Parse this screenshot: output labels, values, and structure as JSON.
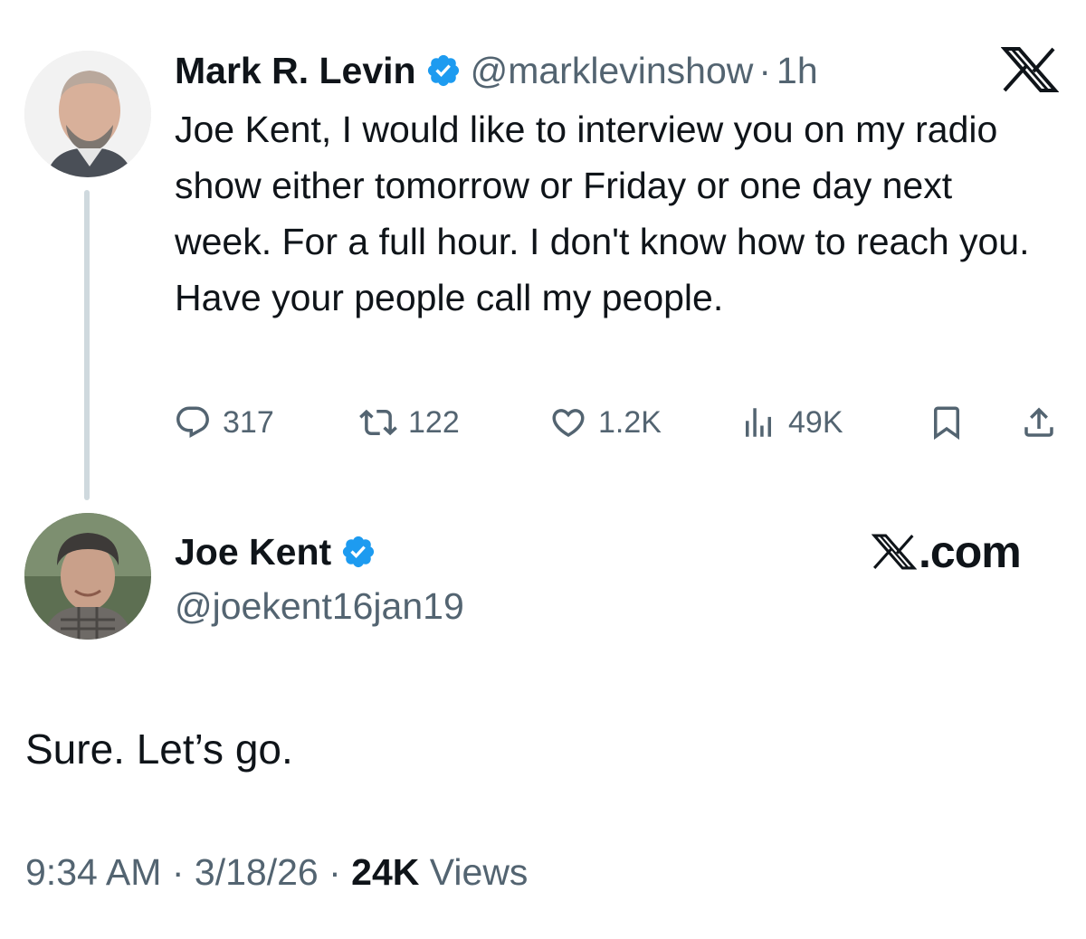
{
  "original_tweet": {
    "display_name": "Mark R. Levin",
    "verified": true,
    "handle": "@marklevinshow",
    "separator": "·",
    "time_ago": "1h",
    "text": "Joe Kent, I would like to interview you on my radio show either tomorrow or Friday or one day next week.  For a full hour.  I don't know how to reach you.  Have your people call my people.",
    "actions": {
      "replies": "317",
      "retweets": "122",
      "likes": "1.2K",
      "views": "49K"
    },
    "icons": [
      "reply-icon",
      "retweet-icon",
      "like-icon",
      "views-icon",
      "bookmark-icon",
      "share-icon",
      "x-logo-icon"
    ]
  },
  "reply_tweet": {
    "display_name": "Joe Kent",
    "verified": true,
    "handle": "@joekent16jan19",
    "brand_text": ".com",
    "text": "Sure. Let’s go.",
    "time": "9:34 AM",
    "separator": "·",
    "date": "3/18/26",
    "views_count": "24K",
    "views_label": "Views"
  },
  "colors": {
    "text_primary": "#0f1419",
    "text_secondary": "#536471",
    "verified_blue": "#1d9bf0",
    "thread_line": "#cfd9de"
  }
}
